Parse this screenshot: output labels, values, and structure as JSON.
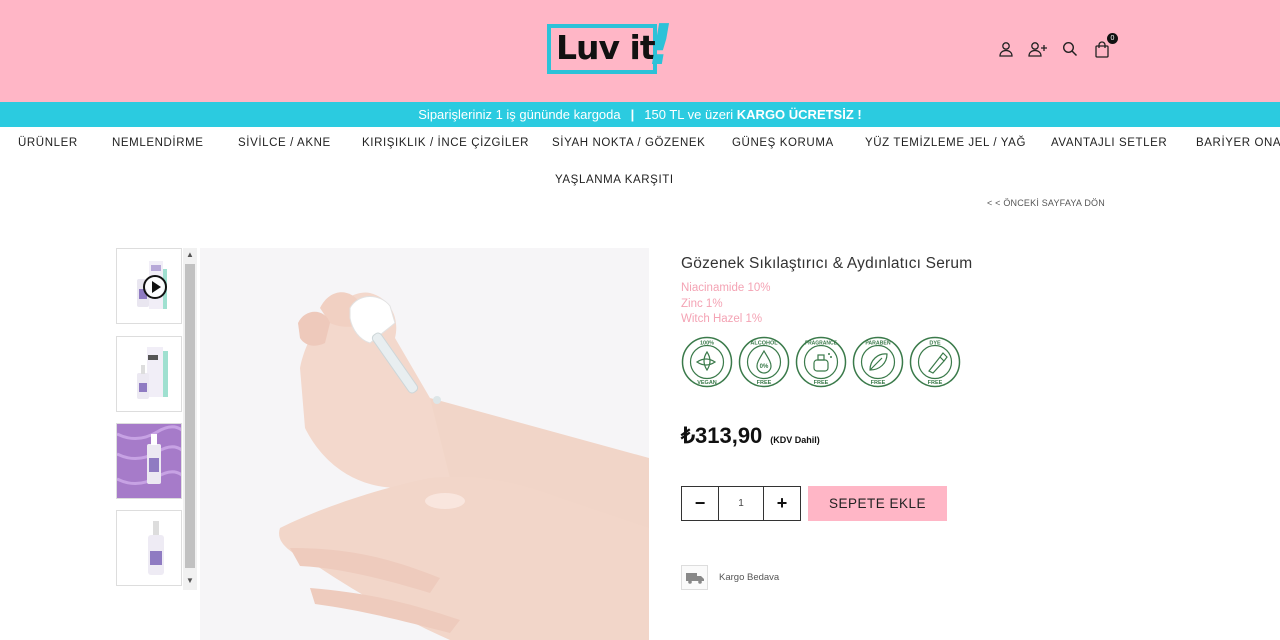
{
  "header": {
    "logo_text": "Luv it",
    "logo_bang": "!",
    "cart_count": "0",
    "icons": [
      "user-icon",
      "add-user-icon",
      "search-icon",
      "shopping-bag-icon"
    ]
  },
  "announcement": {
    "part1": "Siparişleriniz 1 iş gününde kargoda",
    "separator": "|",
    "part2": "150 TL ve üzeri",
    "part3": "KARGO ÜCRETSİZ !"
  },
  "nav": {
    "items": [
      "ÜRÜNLER",
      "NEMLENDİRME",
      "SİVİLCE / AKNE",
      "KIRIŞIKLIK / İNCE ÇİZGİLER",
      "SİYAH NOKTA / GÖZENEK",
      "GÜNEŞ KORUMA",
      "YÜZ TEMİZLEME JEL / YAĞ",
      "AVANTAJLI SETLER",
      "BARİYER ONAR"
    ],
    "row2": "YAŞLANMA KARŞITI"
  },
  "back_link": "< < ÖNCEKİ SAYFAYA DÖN",
  "product": {
    "title": "Gözenek Sıkılaştırıcı & Aydınlatıcı Serum",
    "ingredients": [
      "Niacinamide 10%",
      "Zinc 1%",
      "Witch Hazel 1%"
    ],
    "badges": [
      {
        "top": "100%",
        "bottom": "VEGAN",
        "icon": "leaf-flower-icon"
      },
      {
        "top": "ALCOHOL",
        "center": "0%",
        "bottom": "FREE",
        "icon": "drop-icon"
      },
      {
        "top": "FRAGRANCE",
        "bottom": "FREE",
        "icon": "perfume-icon"
      },
      {
        "top": "PARABEN",
        "bottom": "FREE",
        "icon": "leaf-icon"
      },
      {
        "top": "DYE",
        "bottom": "FREE",
        "icon": "dropper-icon"
      }
    ],
    "price": "₺313,90",
    "price_note": "(KDV Dahil)",
    "quantity": "1",
    "minus": "−",
    "plus": "+",
    "add_to_cart": "SEPETE EKLE",
    "shipping": "Kargo Bedava"
  },
  "colors": {
    "header_bg": "#ffb6c6",
    "announce_bg": "#2bcbe0",
    "accent_pink": "#f4a3b4",
    "badge_green": "#3a7a4a"
  }
}
